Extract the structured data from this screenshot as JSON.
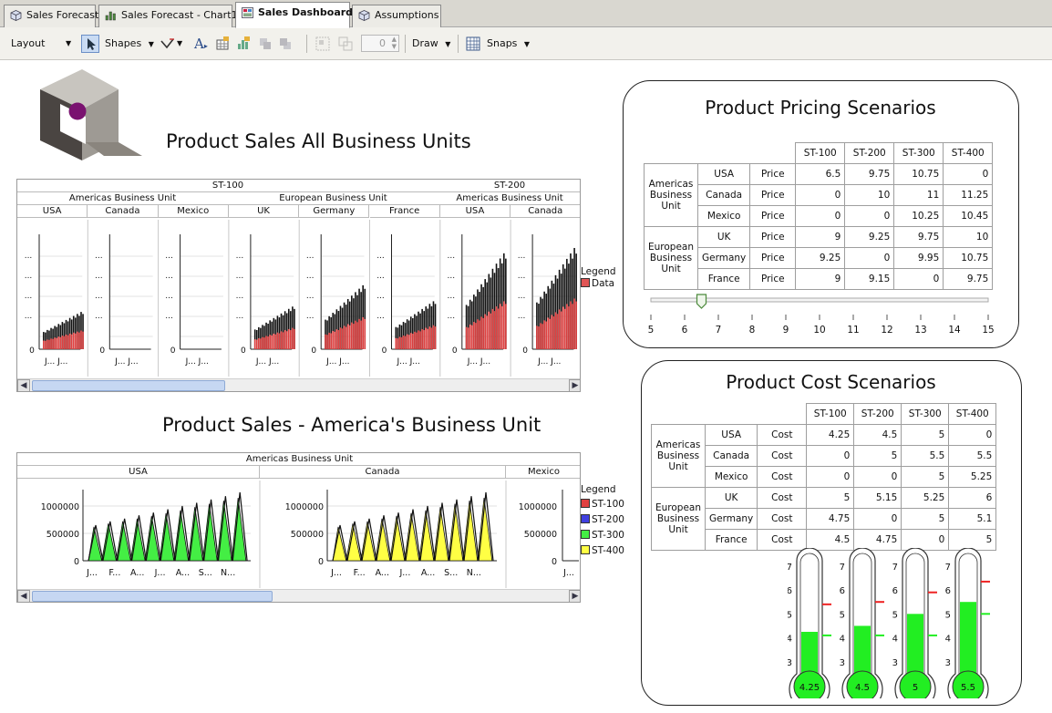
{
  "tabs": [
    {
      "label": "Sales Forecast",
      "icon": "cube-icon",
      "active": false
    },
    {
      "label": "Sales Forecast - Chart1",
      "icon": "chart-icon",
      "active": false
    },
    {
      "label": "Sales Dashboard",
      "icon": "dashboard-icon",
      "active": true
    },
    {
      "label": "Assumptions",
      "icon": "cube-icon",
      "active": false
    }
  ],
  "toolbar": {
    "layout_label": "Layout",
    "shapes_label": "Shapes",
    "draw_label": "Draw",
    "snaps_label": "Snaps",
    "spin_value": "0"
  },
  "headings": {
    "sales_all": "Product Sales All Business Units",
    "sales_america": "Product Sales - America's Business Unit",
    "pricing": "Product Pricing Scenarios",
    "cost": "Product Cost Scenarios"
  },
  "colors": {
    "st100": "#e04040",
    "st200": "#4040e0",
    "st300": "#44ee44",
    "st400": "#ffff44",
    "logo_dot": "#7a1270",
    "thermo_fill": "#22ee22",
    "thermo_red": "#ee2222"
  },
  "chart_data": [
    {
      "type": "bar",
      "group_top": [
        "ST-100",
        "ST-200"
      ],
      "business_units": [
        "Americas Business Unit",
        "European Business Unit",
        "Americas Business Unit"
      ],
      "categories": [
        "USA",
        "Canada",
        "Mexico",
        "UK",
        "Germany",
        "France",
        "USA",
        "Canada"
      ],
      "y_tick_zero": "0",
      "y_tick_ellipsis": "...",
      "x_tick_labels": "J... J...",
      "legend_title": "Legend",
      "series": [
        {
          "name": "Data",
          "relative_levels": [
            0.35,
            0,
            0,
            0.4,
            0.6,
            0.45,
            0.9,
            0.95
          ]
        }
      ]
    },
    {
      "type": "area",
      "business_unit": "Americas Business Unit",
      "categories": [
        "USA",
        "Canada",
        "Mexico"
      ],
      "y_ticks": [
        "0",
        "500000",
        "1000000"
      ],
      "ylim": [
        0,
        1300000
      ],
      "x_ticks": [
        "J...",
        "F...",
        "A...",
        "J...",
        "A...",
        "S...",
        "N..."
      ],
      "x_tick_mexico": "J...",
      "legend_title": "Legend",
      "series": [
        {
          "name": "ST-100"
        },
        {
          "name": "ST-200"
        },
        {
          "name": "ST-300",
          "peaks": [
            620000,
            680000,
            720000,
            770000,
            820000,
            870000,
            920000,
            980000,
            1040000,
            1100000,
            1150000
          ]
        },
        {
          "name": "ST-400",
          "peaks": [
            620000,
            680000,
            720000,
            770000,
            820000,
            870000,
            920000,
            980000,
            1040000,
            1100000,
            1150000
          ]
        }
      ],
      "line_peaks": [
        650000,
        720000,
        770000,
        830000,
        880000,
        940000,
        1000000,
        1060000,
        1120000,
        1180000,
        1250000
      ]
    }
  ],
  "pricing": {
    "headers": [
      "ST-100",
      "ST-200",
      "ST-300",
      "ST-400"
    ],
    "groups": [
      {
        "name": "Americas Business Unit",
        "rows": [
          {
            "country": "USA",
            "measure": "Price",
            "values": [
              "6.5",
              "9.75",
              "10.75",
              "0"
            ]
          },
          {
            "country": "Canada",
            "measure": "Price",
            "values": [
              "0",
              "10",
              "11",
              "11.25"
            ]
          },
          {
            "country": "Mexico",
            "measure": "Price",
            "values": [
              "0",
              "0",
              "10.25",
              "10.45"
            ]
          }
        ]
      },
      {
        "name": "European Business Unit",
        "rows": [
          {
            "country": "UK",
            "measure": "Price",
            "values": [
              "9",
              "9.25",
              "9.75",
              "10"
            ]
          },
          {
            "country": "Germany",
            "measure": "Price",
            "values": [
              "9.25",
              "0",
              "9.95",
              "10.75"
            ]
          },
          {
            "country": "France",
            "measure": "Price",
            "values": [
              "9",
              "9.15",
              "0",
              "9.75"
            ]
          }
        ]
      }
    ],
    "slider": {
      "min": 5,
      "max": 15,
      "value": 6.5,
      "labels": [
        "5",
        "6",
        "7",
        "8",
        "9",
        "10",
        "11",
        "12",
        "13",
        "14",
        "15"
      ]
    }
  },
  "cost": {
    "headers": [
      "ST-100",
      "ST-200",
      "ST-300",
      "ST-400"
    ],
    "groups": [
      {
        "name": "Americas Business Unit",
        "rows": [
          {
            "country": "USA",
            "measure": "Cost",
            "values": [
              "4.25",
              "4.5",
              "5",
              "0"
            ]
          },
          {
            "country": "Canada",
            "measure": "Cost",
            "values": [
              "0",
              "5",
              "5.5",
              "5.5"
            ]
          },
          {
            "country": "Mexico",
            "measure": "Cost",
            "values": [
              "0",
              "0",
              "5",
              "5.25"
            ]
          }
        ]
      },
      {
        "name": "European Business Unit",
        "rows": [
          {
            "country": "UK",
            "measure": "Cost",
            "values": [
              "5",
              "5.15",
              "5.25",
              "6"
            ]
          },
          {
            "country": "Germany",
            "measure": "Cost",
            "values": [
              "4.75",
              "0",
              "5",
              "5.1"
            ]
          },
          {
            "country": "France",
            "measure": "Cost",
            "values": [
              "4.5",
              "4.75",
              "0",
              "5"
            ]
          }
        ]
      }
    ],
    "thermometers": {
      "scale_labels": [
        "3",
        "4",
        "5",
        "6",
        "7"
      ],
      "scale_min": 2.8,
      "scale_max": 7.3,
      "items": [
        {
          "value": 4.25,
          "label": "4.25",
          "green_mark": 4.1,
          "red_mark": 5.4
        },
        {
          "value": 4.5,
          "label": "4.5",
          "green_mark": 4.1,
          "red_mark": 5.5
        },
        {
          "value": 5.0,
          "label": "5",
          "green_mark": 4.1,
          "red_mark": 5.9
        },
        {
          "value": 5.5,
          "label": "5.5",
          "green_mark": 5.0,
          "red_mark": 6.35
        }
      ]
    }
  }
}
